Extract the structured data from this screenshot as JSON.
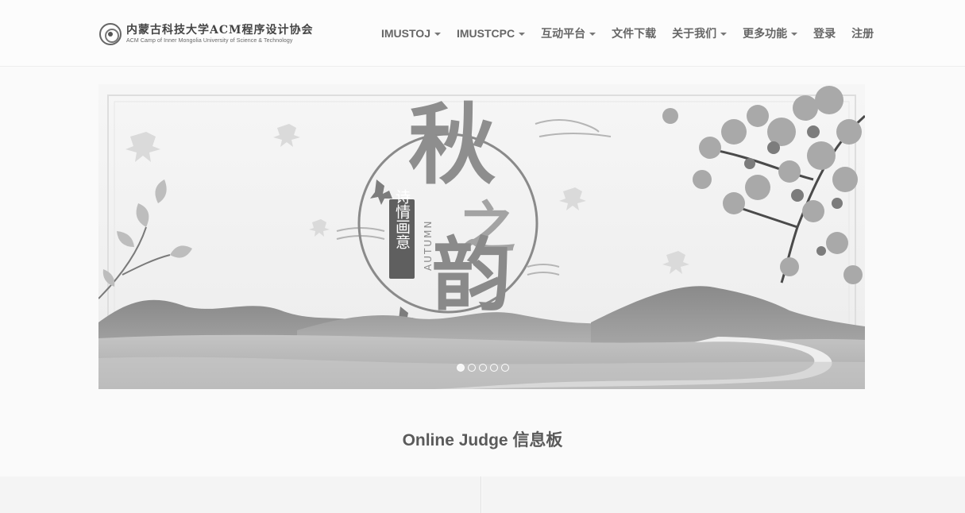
{
  "header": {
    "logo_cn": "内蒙古科技大学ACM程序设计协会",
    "logo_en": "ACM Camp of Inner Mongolia University of Science & Technology"
  },
  "nav": {
    "imustoj": "IMUSTOJ",
    "imustcpc": "IMUSTCPC",
    "interact": "互动平台",
    "download": "文件下载",
    "about": "关于我们",
    "more": "更多功能",
    "login": "登录",
    "register": "注册"
  },
  "banner": {
    "title_char_1": "秋",
    "title_char_2": "之",
    "title_char_3": "韵",
    "subtitle": "诗情画意",
    "en_word": "AUTUMN",
    "slides_total": 5,
    "active_slide": 1
  },
  "section": {
    "title": "Online Judge 信息板"
  },
  "colors": {
    "background": "#fafafa",
    "text": "#555555",
    "nav_text": "#666666"
  }
}
